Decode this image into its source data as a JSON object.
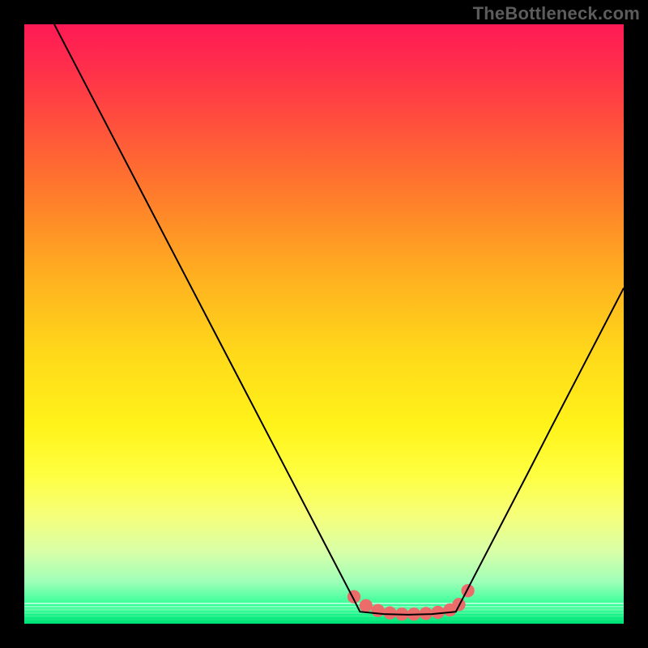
{
  "watermark": "TheBottleneck.com",
  "chart_data": {
    "type": "line",
    "title": "",
    "xlabel": "",
    "ylabel": "",
    "xlim": [
      0,
      100
    ],
    "ylim": [
      0,
      100
    ],
    "grid": false,
    "legend": false,
    "description": "Black V-shaped bottleneck curve over a vertical spectral gradient (red at top through yellow to green at bottom). Minimum of the curve is between x≈56 and x≈72 at y≈2. A salmon-colored marker band sits at the trough.",
    "series": [
      {
        "name": "bottleneck-curve-left",
        "color": "#000000",
        "x": [
          5,
          10,
          15,
          20,
          25,
          30,
          35,
          40,
          45,
          50,
          55,
          56
        ],
        "values": [
          100,
          90.4,
          80.8,
          71.2,
          61.6,
          52.0,
          42.4,
          32.8,
          23.2,
          13.6,
          4.0,
          2.0
        ]
      },
      {
        "name": "bottleneck-curve-trough",
        "color": "#000000",
        "x": [
          56,
          60,
          64,
          68,
          72
        ],
        "values": [
          2.0,
          1.6,
          1.5,
          1.6,
          2.0
        ]
      },
      {
        "name": "bottleneck-curve-right",
        "color": "#000000",
        "x": [
          72,
          76,
          80,
          84,
          88,
          92,
          96,
          100
        ],
        "values": [
          2.0,
          9.7,
          17.4,
          25.1,
          32.9,
          40.6,
          48.3,
          56.0
        ]
      },
      {
        "name": "optimum-band-markers",
        "color": "#ec6b6b",
        "x": [
          55,
          57,
          59,
          61,
          63,
          65,
          67,
          69,
          71,
          72.5,
          74
        ],
        "values": [
          4.5,
          3.0,
          2.2,
          1.8,
          1.6,
          1.6,
          1.7,
          1.9,
          2.3,
          3.2,
          5.5
        ]
      }
    ],
    "background_gradient": {
      "direction": "vertical",
      "stops": [
        {
          "pos": 0.0,
          "color": "#ff1a55"
        },
        {
          "pos": 0.28,
          "color": "#ff7a2c"
        },
        {
          "pos": 0.55,
          "color": "#ffd91a"
        },
        {
          "pos": 0.82,
          "color": "#f6ff7a"
        },
        {
          "pos": 0.96,
          "color": "#4cffa0"
        },
        {
          "pos": 1.0,
          "color": "#00e070"
        }
      ]
    }
  }
}
